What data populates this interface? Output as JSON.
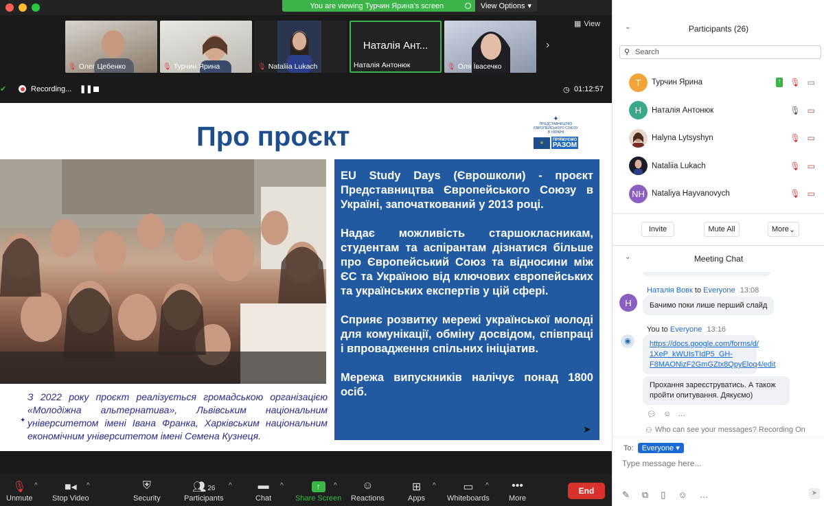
{
  "banner": {
    "text": "You are viewing Турчин Ярина's screen",
    "view_options": "View Options"
  },
  "thumbnails": [
    {
      "name": "Олег Цебенко"
    },
    {
      "name": "Турчин Ярина"
    },
    {
      "name": "Nataliia Lukach"
    },
    {
      "name": "Наталія Антонюк",
      "big": "Наталія Ант..."
    },
    {
      "name": "Оля Ївасечко"
    }
  ],
  "view_label": "View",
  "recording": {
    "label": "Recording...",
    "timer": "01:12:57"
  },
  "slide": {
    "title": "Про проєкт",
    "logo_lines": [
      "ПРЕДСТАВНИЦТВО",
      "ЄВРОПЕЙСЬКОГО СОЮЗУ",
      "В УКРАЇНІ",
      "ПРЯМУЄМО",
      "РАЗОМ"
    ],
    "paragraphs": [
      "EU Study Days (Єврошколи) - проєкт Представництва Європейського Союзу в Україні, започаткований у 2013 році.",
      "Надає можливість старшокласникам, студентам та аспірантам дізнатися більше про Європейський Союз та відносини між ЄС та Україною від ключових європейських та українських експертів у цій сфері.",
      "Сприяє розвитку мережі української молоді для комунікації, обміну досвідом, співпраці і впровадження спільних ініціатив.",
      "Мережа випускників налічує понад 1800 осіб."
    ],
    "caption": "З 2022 року проєкт реалізується громадською організацією «Молодіжна альтернатива», Львівським національним університетом імені Івана Франка, Харківським національним економічним університетом імені Семена Кузнеця."
  },
  "toolbar": {
    "unmute": "Unmute",
    "stop_video": "Stop Video",
    "security": "Security",
    "participants": "Participants",
    "participants_count": "26",
    "chat": "Chat",
    "share_screen": "Share Screen",
    "reactions": "Reactions",
    "apps": "Apps",
    "whiteboards": "Whiteboards",
    "more": "More",
    "end": "End"
  },
  "panel": {
    "participants_title": "Participants (26)",
    "search_placeholder": "Search",
    "participants": [
      {
        "initials": "Т",
        "name": "Турчин Ярина",
        "color": "#f2a33a"
      },
      {
        "initials": "Н",
        "name": "Наталія Антонюк",
        "color": "#3aa88a"
      },
      {
        "initials": "",
        "name": "Halyna Lytsyshyn",
        "color": "#7a5a4a"
      },
      {
        "initials": "",
        "name": "Nataliia Lukach",
        "color": "#2a2a3a"
      },
      {
        "initials": "NH",
        "name": "Nataliya Hayvanovych",
        "color": "#8a5fc0"
      }
    ],
    "invite": "Invite",
    "mute_all": "Mute All",
    "more": "More",
    "chat_title": "Meeting Chat",
    "messages": [
      {
        "from": "Наталія Вовк",
        "to_word": "to",
        "to": "Everyone",
        "time": "13:08",
        "text": "Бачимо поки лише перший слайд",
        "initial": "Н"
      },
      {
        "from": "You",
        "to_word": "to",
        "to": "Everyone",
        "time": "13:16",
        "link": "https://docs.google.com/forms/d/1XeP_kWUIsTIdP5_GH-F8MAONizF2GmGZtx8QpyEloq4/edit",
        "link_lines": [
          "https://docs.google.com/forms/d/",
          "1XeP_kWUIsTIdP5_GH-",
          "F8MAONizF2GmGZtx8QpyEloq4/edit"
        ],
        "text2": "Прохання зареєструватись. А також пройти опитування. Дякуємо)"
      }
    ],
    "visibility_note": "Who can see your messages? Recording On",
    "to_label": "To:",
    "to_value": "Everyone",
    "input_placeholder": "Type message here..."
  }
}
